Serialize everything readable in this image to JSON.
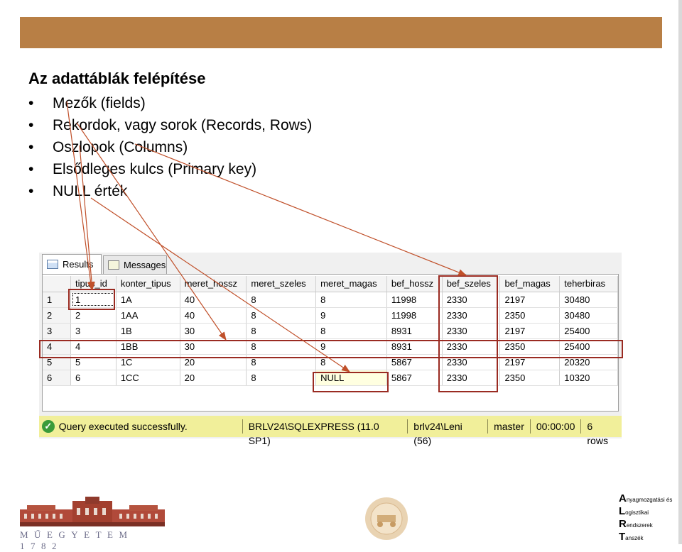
{
  "slide": {
    "title": "Az adattáblák felépítése",
    "bullets": [
      "Mezők (fields)",
      "Rekordok, vagy sorok (Records, Rows)",
      "Oszlopok (Columns)",
      "Elsődleges kulcs (Primary key)",
      "NULL érték"
    ],
    "header_color": "#b87f45",
    "annotation_color": "#c0502a"
  },
  "ssms": {
    "tabs": [
      {
        "label": "Results",
        "icon": "grid-icon"
      },
      {
        "label": "Messages",
        "icon": "messages-icon"
      }
    ],
    "columns": [
      "",
      "tipus_id",
      "konter_tipus",
      "meret_hossz",
      "meret_szeles",
      "meret_magas",
      "bef_hossz",
      "bef_szeles",
      "bef_magas",
      "teherbiras"
    ],
    "rows": [
      [
        "1",
        "1",
        "1A",
        "40",
        "8",
        "8",
        "11998",
        "2330",
        "2197",
        "30480"
      ],
      [
        "2",
        "2",
        "1AA",
        "40",
        "8",
        "9",
        "11998",
        "2330",
        "2350",
        "30480"
      ],
      [
        "3",
        "3",
        "1B",
        "30",
        "8",
        "8",
        "8931",
        "2330",
        "2197",
        "25400"
      ],
      [
        "4",
        "4",
        "1BB",
        "30",
        "8",
        "9",
        "8931",
        "2330",
        "2350",
        "25400"
      ],
      [
        "5",
        "5",
        "1C",
        "20",
        "8",
        "8",
        "5867",
        "2330",
        "2197",
        "20320"
      ],
      [
        "6",
        "6",
        "1CC",
        "20",
        "8",
        "NULL",
        "5867",
        "2330",
        "2350",
        "10320"
      ]
    ],
    "status": {
      "message": "Query executed successfully.",
      "server": "BRLV24\\SQLEXPRESS (11.0 SP1)",
      "user": "brlv24\\Leni (56)",
      "database": "master",
      "elapsed": "00:00:00",
      "rows": "6 rows"
    }
  },
  "footer": {
    "university": "MŰEGYETEM 1782",
    "seal_text": "BME KÖZLEKEDÉSMÉRNÖKI KAR · 1951",
    "dept": [
      {
        "initial": "A",
        "rest": "nyagmozgatási és"
      },
      {
        "initial": "L",
        "rest": "ogisztikai"
      },
      {
        "initial": "R",
        "rest": "endszerek"
      },
      {
        "initial": "T",
        "rest": "anszék"
      }
    ]
  }
}
